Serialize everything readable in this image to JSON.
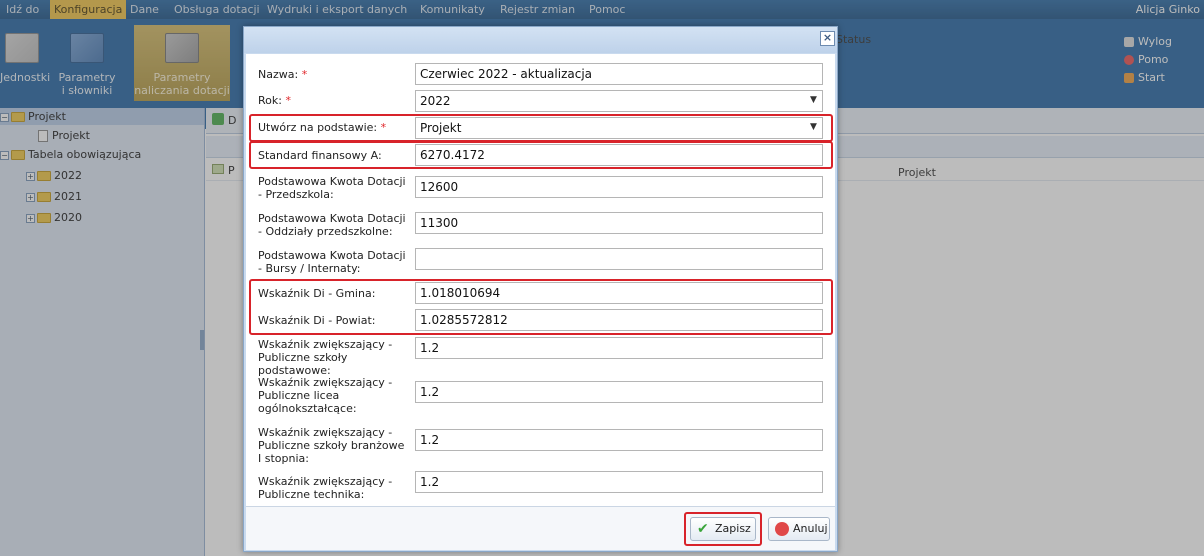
{
  "menu": {
    "items": [
      "Idź do",
      "Konfiguracja",
      "Dane",
      "Obsługa dotacji",
      "Wydruki i eksport danych",
      "Komunikaty",
      "Rejestr zmian",
      "Pomoc"
    ],
    "active_index": 1,
    "user": "Alicja Ginko"
  },
  "ribbon": {
    "btn_units": "Jednostki",
    "btn_params_1": "Parametry",
    "btn_params_2": "i słowniki",
    "btn_calc_1": "Parametry",
    "btn_calc_2": "naliczania dotacji",
    "right_logout": "Wylog",
    "right_help": "Pomo",
    "right_start": "Start"
  },
  "tree": {
    "root": "Projekt",
    "root_child": "Projekt",
    "table": "Tabela obowiązująca",
    "years": [
      "2022",
      "2021",
      "2020"
    ]
  },
  "grid": {
    "toolbar_fragment": "D",
    "row_fragment": "P",
    "status_header": "Status",
    "status_value": "Projekt"
  },
  "dialog": {
    "close": "×",
    "fields": [
      {
        "label": "Nazwa:",
        "required": true,
        "value": "Czerwiec 2022 - aktualizacja",
        "type": "text"
      },
      {
        "label": "Rok:",
        "required": true,
        "value": "2022",
        "type": "select"
      },
      {
        "label": "Utwórz na podstawie:",
        "required": true,
        "value": "Projekt",
        "type": "select"
      },
      {
        "label": "Standard finansowy A:",
        "required": false,
        "value": "6270.4172",
        "type": "text"
      },
      {
        "label": "Podstawowa Kwota Dotacji - Przedszkola:",
        "required": false,
        "value": "12600",
        "type": "text"
      },
      {
        "label": "Podstawowa Kwota Dotacji - Oddziały przedszkolne:",
        "required": false,
        "value": "11300",
        "type": "text"
      },
      {
        "label": "Podstawowa Kwota Dotacji - Bursy / Internaty:",
        "required": false,
        "value": "",
        "type": "text"
      },
      {
        "label": "Wskaźnik Di - Gmina:",
        "required": false,
        "value": "1.018010694",
        "type": "text"
      },
      {
        "label": "Wskaźnik Di - Powiat:",
        "required": false,
        "value": "1.0285572812",
        "type": "text"
      },
      {
        "label": "Wskaźnik zwiększający - Publiczne szkoły podstawowe:",
        "required": false,
        "value": "1.2",
        "type": "text"
      },
      {
        "label": "Wskaźnik zwiększający - Publiczne licea ogólnokształcące:",
        "required": false,
        "value": "1.2",
        "type": "text"
      },
      {
        "label": "Wskaźnik zwiększający - Publiczne szkoły branżowe I stopnia:",
        "required": false,
        "value": "1.2",
        "type": "text"
      },
      {
        "label": "Wskaźnik zwiększający - Publiczne technika:",
        "required": false,
        "value": "1.2",
        "type": "text"
      }
    ],
    "save": "Zapisz",
    "cancel": "Anuluj"
  },
  "colors": {
    "highlight": "#d8232a",
    "required": "#e0262a",
    "active_menu": "#f3c64b"
  }
}
